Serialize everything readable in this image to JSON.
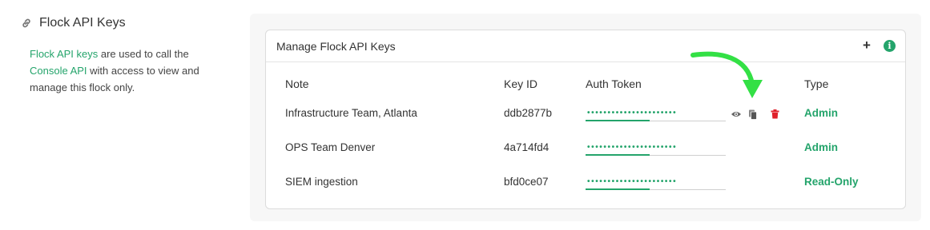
{
  "section": {
    "title": "Flock API Keys",
    "desc_link1": "Flock API keys",
    "desc_text1": " are used to call the ",
    "desc_link2": "Console API",
    "desc_text2": " with access to view and manage this flock only."
  },
  "card": {
    "title": "Manage Flock API Keys",
    "add_label": "+",
    "info_label": "i"
  },
  "table": {
    "headers": {
      "note": "Note",
      "key_id": "Key ID",
      "auth_token": "Auth Token",
      "type": "Type"
    },
    "rows": [
      {
        "note": "Infrastructure Team, Atlanta",
        "key_id": "ddb2877b",
        "token": "••••••••••••••••••••••",
        "type": "Admin"
      },
      {
        "note": "OPS Team Denver",
        "key_id": "4a714fd4",
        "token": "••••••••••••••••••••••",
        "type": "Admin"
      },
      {
        "note": "SIEM ingestion",
        "key_id": "bfd0ce07",
        "token": "••••••••••••••••••••••",
        "type": "Read-Only"
      }
    ]
  },
  "colors": {
    "accent": "#24a46b",
    "delete": "#e0212b",
    "arrow": "#33e045"
  },
  "icons": [
    "link-icon",
    "plus-icon",
    "info-icon",
    "eye-icon",
    "copy-icon",
    "trash-icon",
    "arrow-annotation"
  ]
}
